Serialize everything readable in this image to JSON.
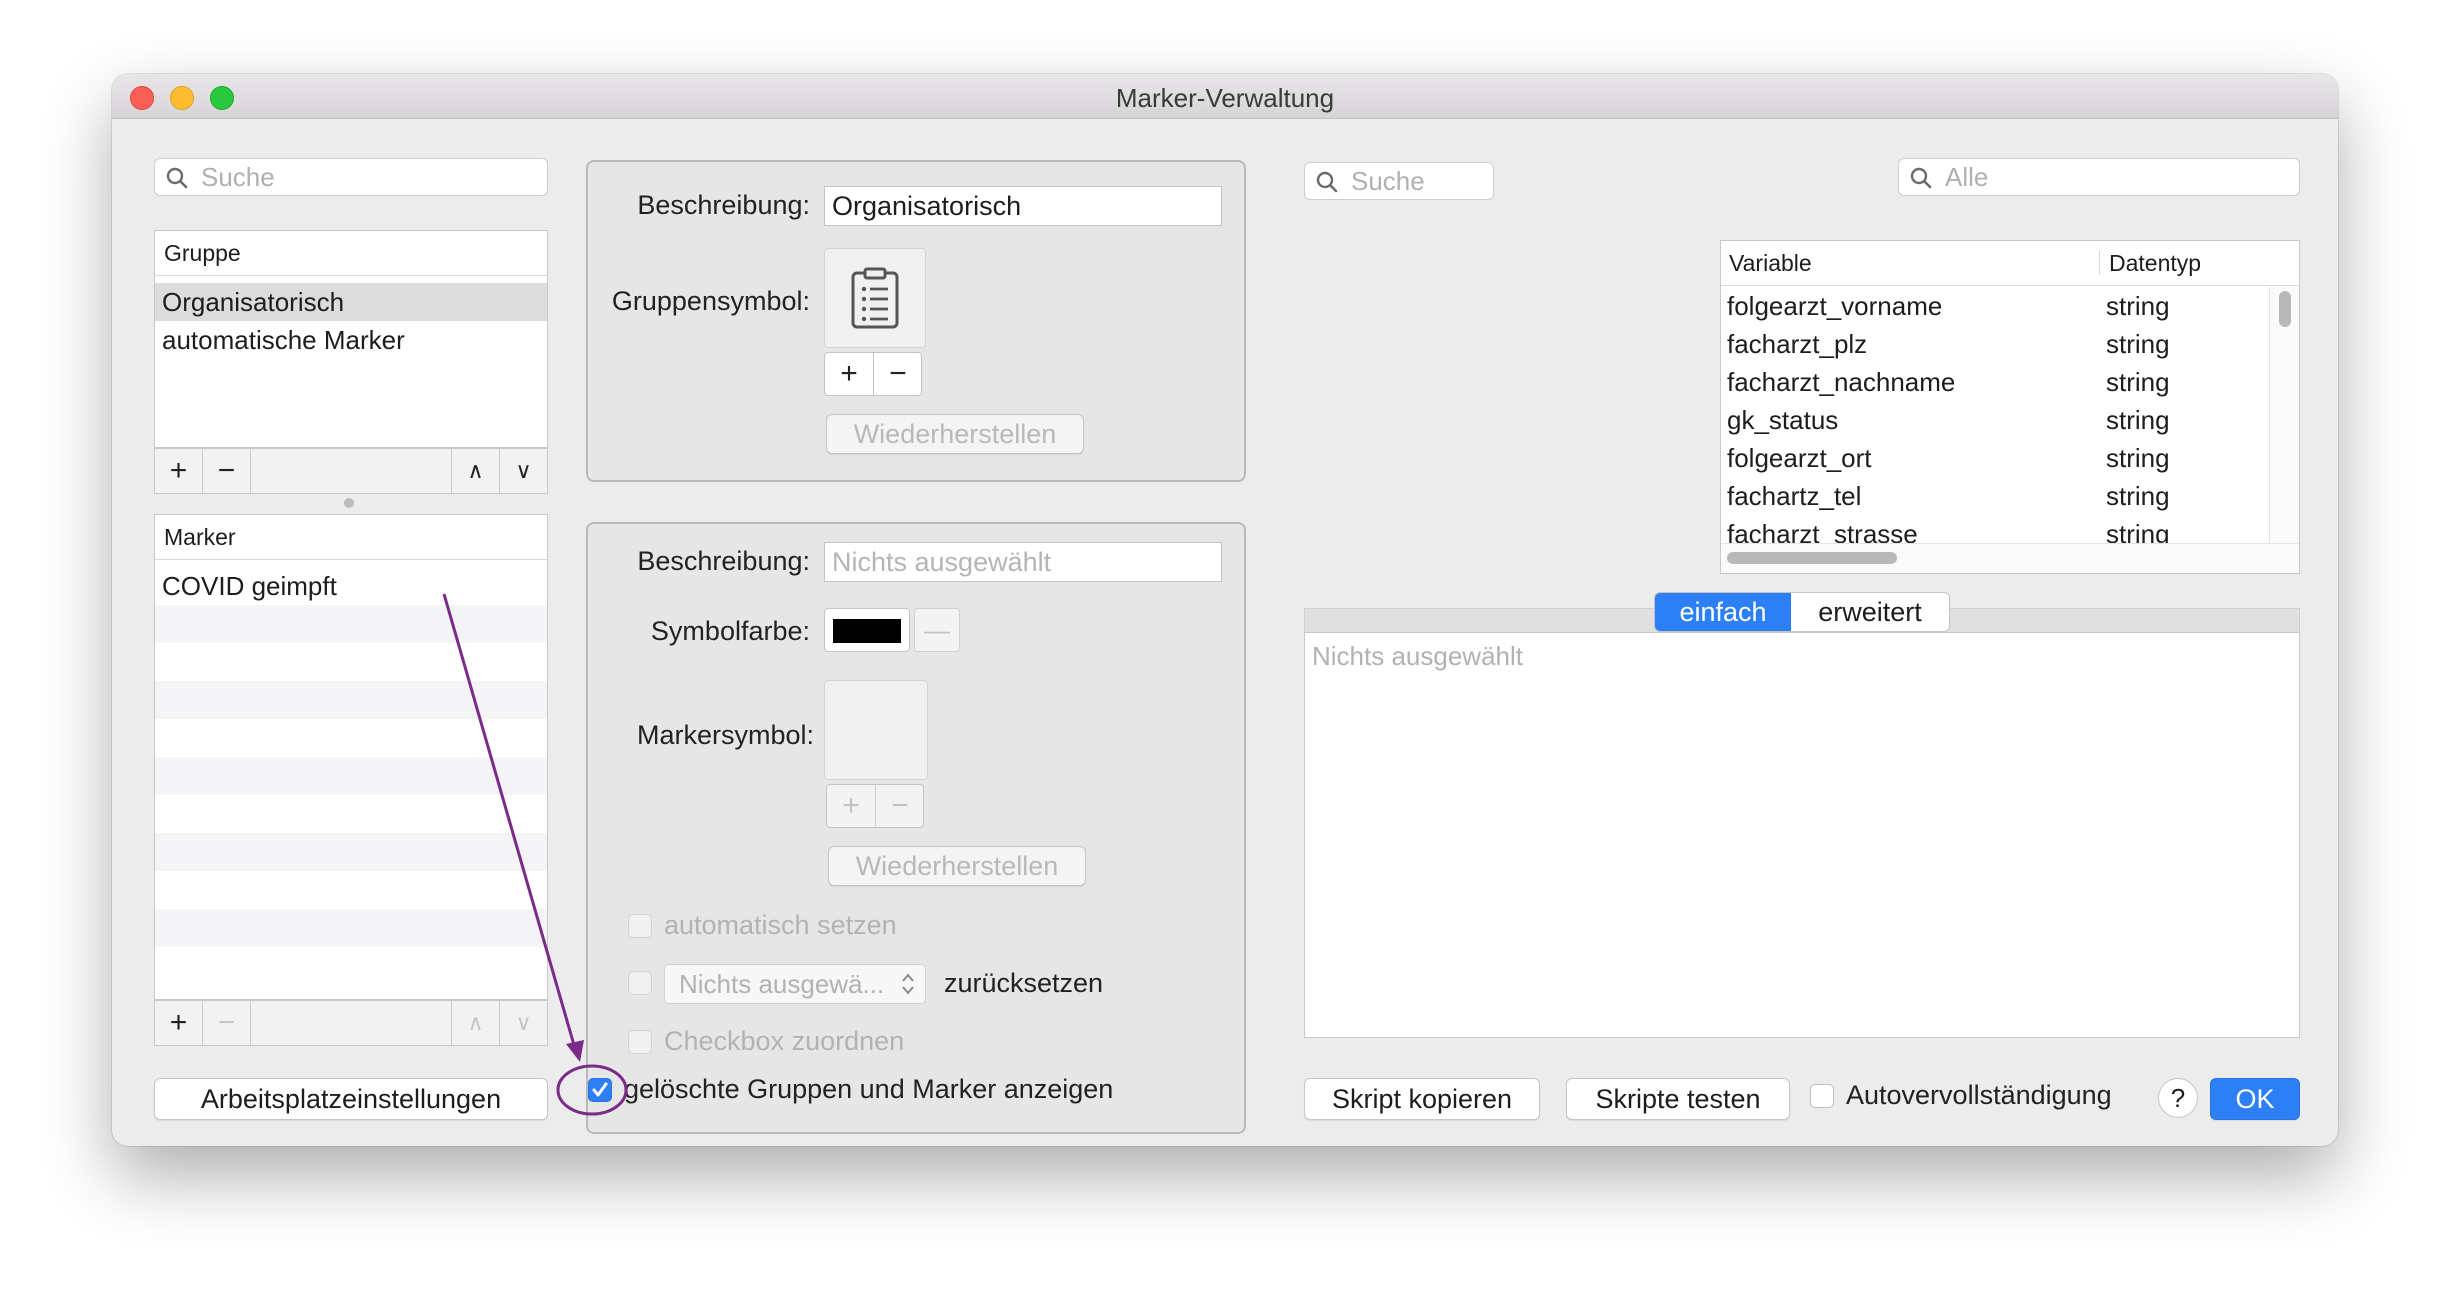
{
  "window": {
    "title": "Marker-Verwaltung"
  },
  "left": {
    "search_placeholder": "Suche",
    "group_list": {
      "header": "Gruppe",
      "items": [
        "Organisatorisch",
        "automatische Marker"
      ]
    },
    "marker_list": {
      "header": "Marker",
      "items": [
        "COVID geimpft"
      ]
    },
    "buttons": {
      "add": "+",
      "remove": "−",
      "up": "∧",
      "down": "∨"
    },
    "workplace_button": "Arbeitsplatzeinstellungen"
  },
  "group_detail": {
    "description_label": "Beschreibung:",
    "description_value": "Organisatorisch",
    "symbol_label": "Gruppensymbol:",
    "symbol_icon": "clipboard-list-icon",
    "restore_button": "Wiederherstellen"
  },
  "marker_detail": {
    "description_label": "Beschreibung:",
    "description_placeholder": "Nichts ausgewählt",
    "color_label": "Symbolfarbe:",
    "color_value": "#000000",
    "color_clear": "—",
    "symbol_label": "Markersymbol:",
    "restore_button": "Wiederherstellen",
    "auto_set_label": "automatisch setzen",
    "reset_select_value": "Nichts ausgewä...",
    "reset_label": "zurücksetzen",
    "checkbox_assign_label": "Checkbox zuordnen"
  },
  "show_deleted": {
    "label": "gelöschte Gruppen und Marker anzeigen",
    "checked": true
  },
  "right": {
    "search_placeholder": "Suche",
    "filter_placeholder": "Alle",
    "variables_table": {
      "columns": [
        "Variable",
        "Datentyp"
      ],
      "rows": [
        [
          "folgearzt_vorname",
          "string"
        ],
        [
          "facharzt_plz",
          "string"
        ],
        [
          "facharzt_nachname",
          "string"
        ],
        [
          "gk_status",
          "string"
        ],
        [
          "folgearzt_ort",
          "string"
        ],
        [
          "fachartz_tel",
          "string"
        ],
        [
          "facharzt_strasse",
          "string"
        ]
      ]
    },
    "mode_tabs": [
      "einfach",
      "erweitert"
    ],
    "active_mode": "einfach",
    "editor_placeholder": "Nichts ausgewählt",
    "copy_script_button": "Skript kopieren",
    "test_scripts_button": "Skripte testen",
    "autocomplete_label": "Autovervollständigung",
    "help_button": "?",
    "ok_button": "OK"
  },
  "colors": {
    "accent": "#2c7ff5",
    "annotation": "#7b2a8a"
  }
}
